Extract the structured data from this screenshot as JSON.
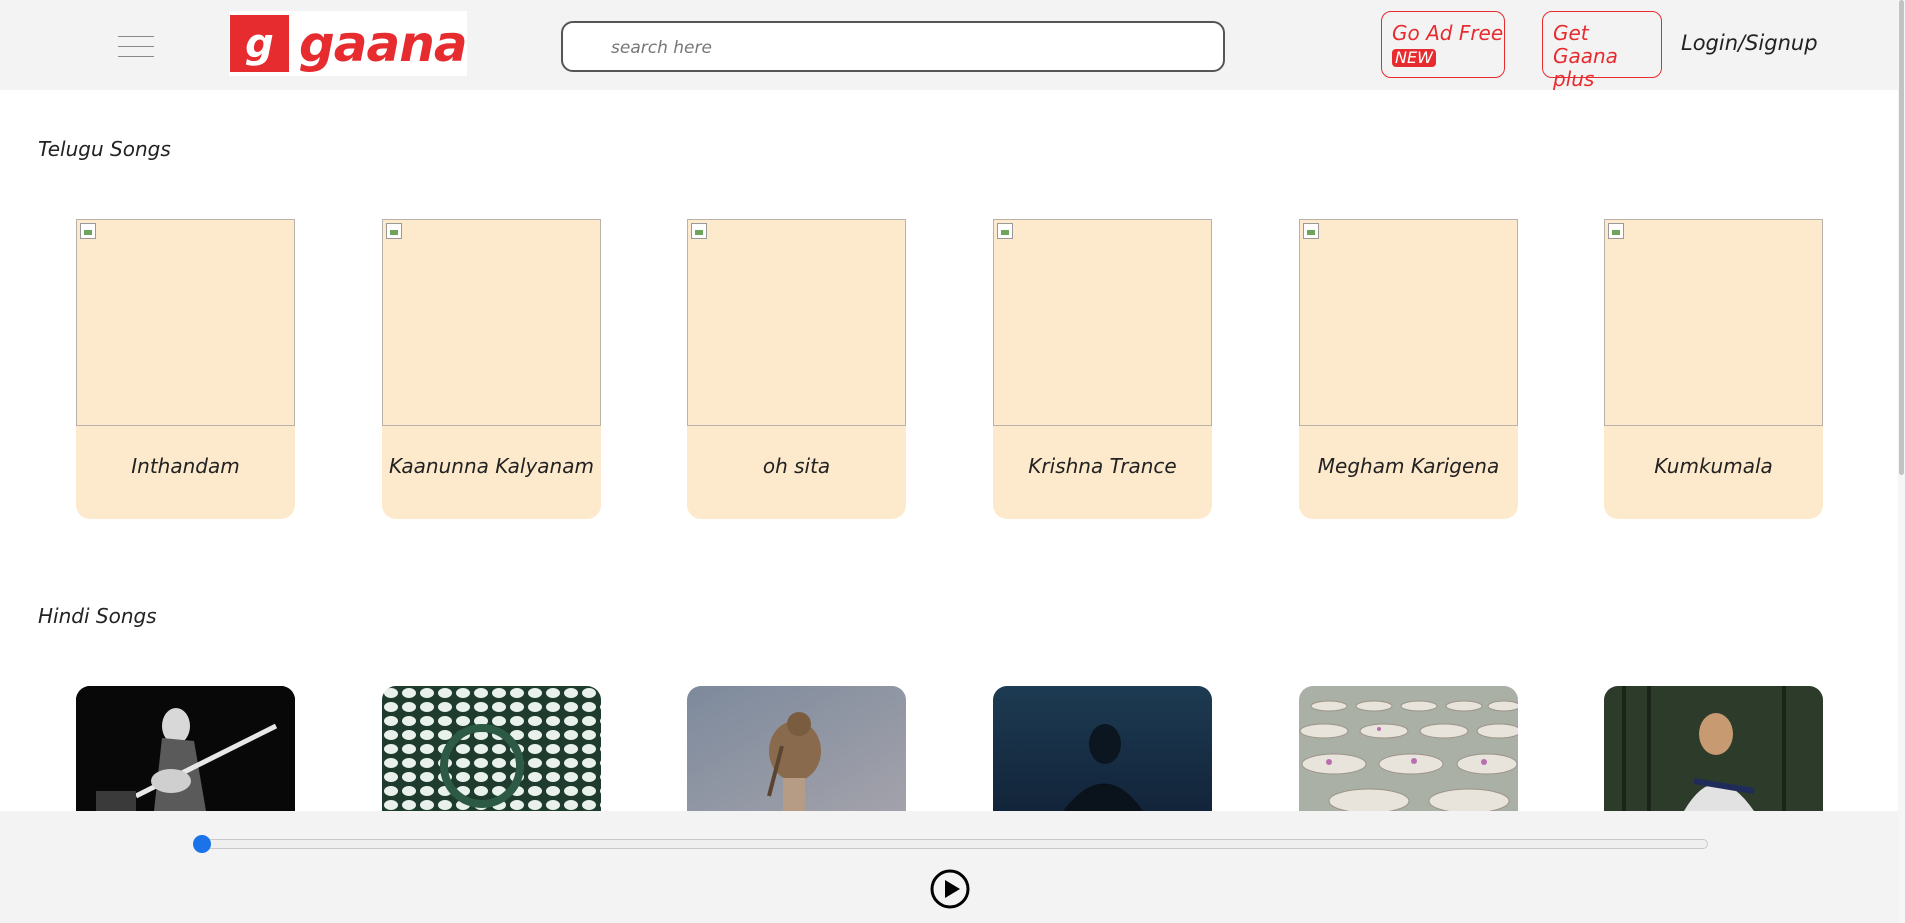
{
  "header": {
    "logo_letter": "g",
    "logo_text": "gaana",
    "search_placeholder": "search here",
    "go_ad_free_label": "Go Ad Free",
    "new_badge": "NEW",
    "get_gaana_plus_label": "Get Gaana plus",
    "login_label": "Login/Signup",
    "brand_color": "#e72c30"
  },
  "sections": [
    {
      "title": "Telugu Songs",
      "cards": [
        {
          "title": "Inthandam"
        },
        {
          "title": "Kaanunna Kalyanam"
        },
        {
          "title": "oh sita"
        },
        {
          "title": "Krishna Trance"
        },
        {
          "title": "Megham Karigena"
        },
        {
          "title": "Kumkumala"
        }
      ]
    },
    {
      "title": "Hindi Songs",
      "cards": [
        {
          "image": "bassist-black-white-photo"
        },
        {
          "image": "plant-cell-pattern-photo"
        },
        {
          "image": "sparrow-on-branch-photo"
        },
        {
          "image": "singer-blue-light-photo"
        },
        {
          "image": "lotus-pots-photo"
        },
        {
          "image": "guitarist-outdoor-photo"
        }
      ]
    }
  ],
  "player": {
    "progress": 0,
    "play_icon": "play-circle-icon",
    "accent_color": "#1a73e8"
  }
}
